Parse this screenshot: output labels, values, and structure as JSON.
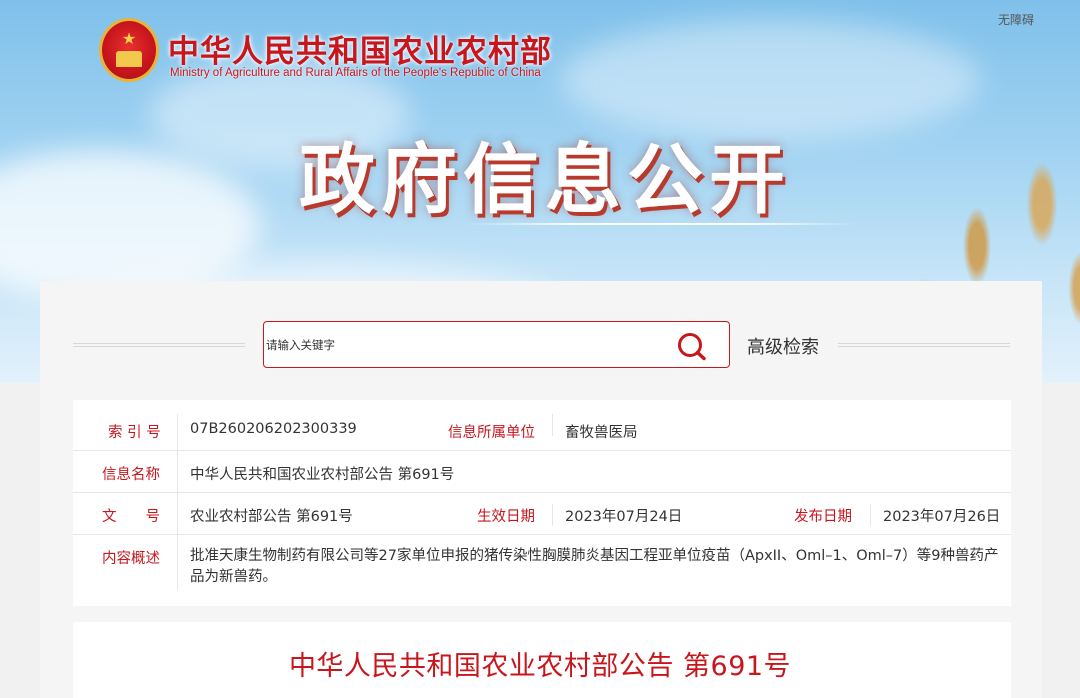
{
  "header": {
    "accessibility_label": "无障碍",
    "ministry_name_cn": "中华人民共和国农业农村部",
    "ministry_name_en": "Ministry of Agriculture and Rural Affairs of the People's Republic of China",
    "page_heading": "政府信息公开"
  },
  "search": {
    "placeholder": "请输入关键字",
    "advanced_label": "高级检索",
    "icon": "search-icon"
  },
  "info": {
    "index_label": "索 引 号",
    "index_value": "07B260206202300339",
    "unit_label": "信息所属单位",
    "unit_value": "畜牧兽医局",
    "name_label": "信息名称",
    "name_value": "中华人民共和国农业农村部公告 第691号",
    "doc_label": "文　　号",
    "doc_value": "农业农村部公告 第691号",
    "effective_label": "生效日期",
    "effective_value": "2023年07月24日",
    "publish_label": "发布日期",
    "publish_value": "2023年07月26日",
    "summary_label": "内容概述",
    "summary_value": "批准天康生物制药有限公司等27家单位申报的猪传染性胸膜肺炎基因工程亚单位疫苗（ApxII、Oml–1、Oml–7）等9种兽药产品为新兽药。"
  },
  "article": {
    "title": "中华人民共和国农业农村部公告 第691号"
  },
  "colors": {
    "brand_red": "#c8161d",
    "text": "#333333",
    "panel_bg": "#f5f5f5"
  }
}
